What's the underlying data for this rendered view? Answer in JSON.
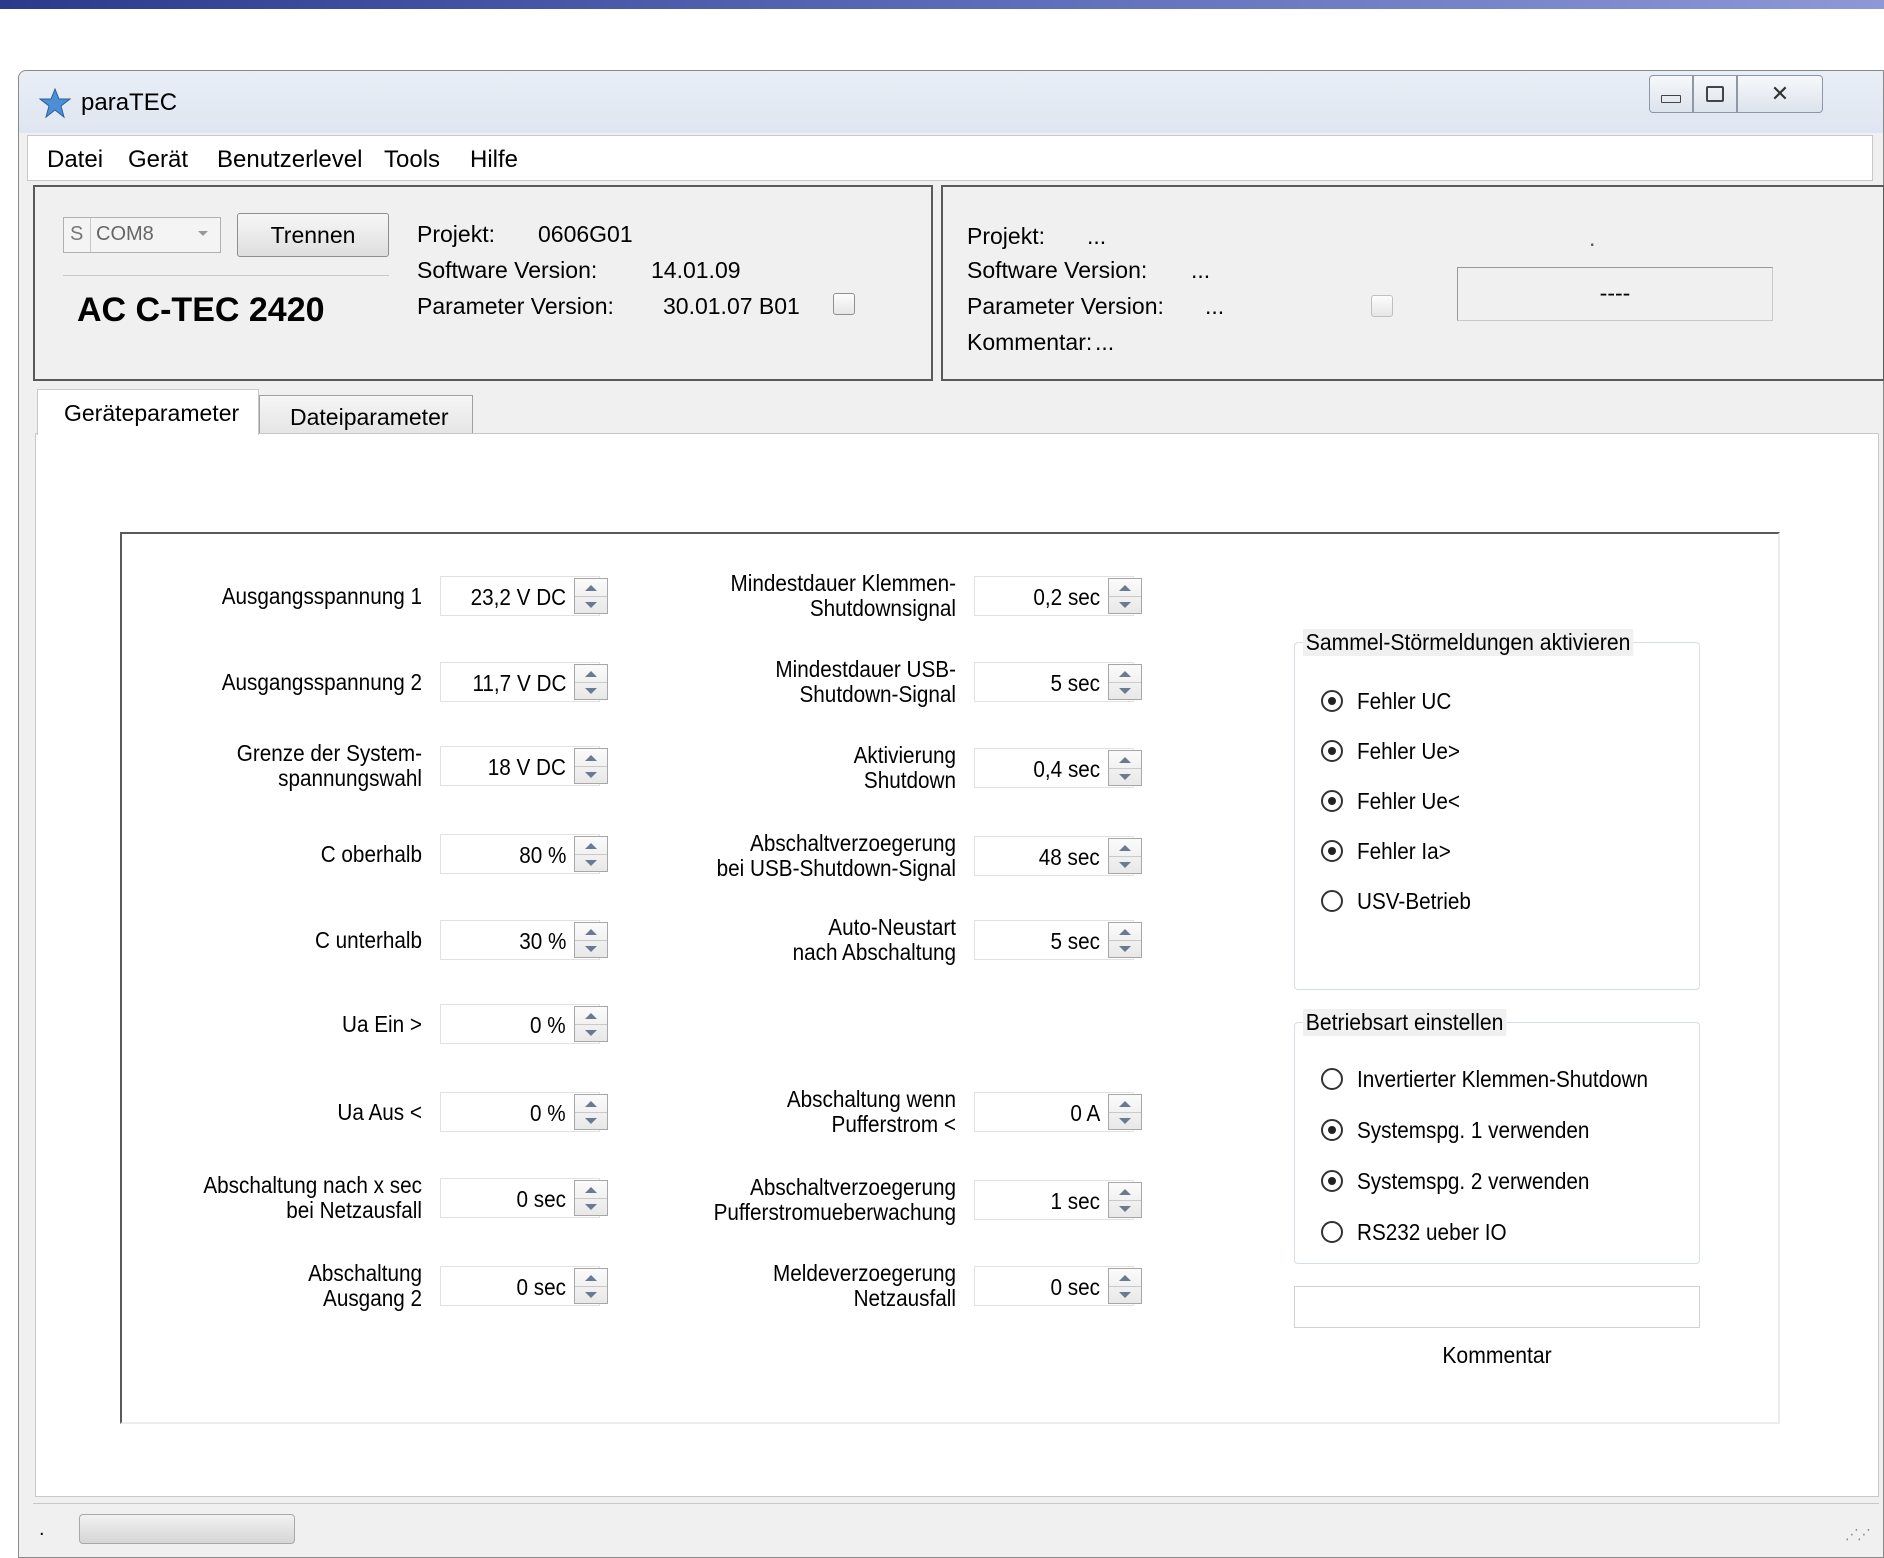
{
  "window": {
    "title": "paraTEC",
    "icon": "star-icon"
  },
  "menu": [
    "Datei",
    "Gerät",
    "Benutzerlevel",
    "Tools",
    "Hilfe"
  ],
  "connection": {
    "prefix": "S",
    "port": "COM8",
    "disconnect_label": "Trennen",
    "device_name": "AC C-TEC 2420",
    "project_label": "Projekt:",
    "project_value": "0606G01",
    "software_label": "Software Version:",
    "software_value": "14.01.09",
    "parameter_label": "Parameter Version:",
    "parameter_value": "30.01.07 B01",
    "parameter_checked": false
  },
  "file_info": {
    "project_label": "Projekt:",
    "project_value": "...",
    "software_label": "Software Version:",
    "software_value": "...",
    "parameter_label": "Parameter Version:",
    "parameter_value": "...",
    "comment_label": "Kommentar:",
    "comment_value": "...",
    "dot": ".",
    "display_value": "----"
  },
  "tabs": [
    "Geräteparameter",
    "Dateiparameter"
  ],
  "active_tab": "Geräteparameter",
  "left_params": [
    {
      "label": "Ausgangsspannung 1",
      "value": "23,2 V DC"
    },
    {
      "label": "Ausgangsspannung 2",
      "value": "11,7 V DC"
    },
    {
      "label": "Grenze der System-\nspannungswahl",
      "value": "18 V DC"
    },
    {
      "label": "C oberhalb",
      "value": "80 %"
    },
    {
      "label": "C unterhalb",
      "value": "30 %"
    },
    {
      "label": "Ua Ein  >",
      "value": "0 %"
    },
    {
      "label": "Ua Aus <",
      "value": "0 %"
    },
    {
      "label": "Abschaltung nach x sec\nbei Netzausfall",
      "value": "0 sec"
    },
    {
      "label": "Abschaltung\nAusgang 2",
      "value": "0 sec"
    }
  ],
  "mid_params": [
    {
      "label": "Mindestdauer Klemmen-\nShutdownsignal",
      "value": "0,2 sec"
    },
    {
      "label": "Mindestdauer USB-\nShutdown-Signal",
      "value": "5 sec"
    },
    {
      "label": "Aktivierung\nShutdown",
      "value": "0,4 sec"
    },
    {
      "label": "Abschaltverzoegerung\nbei USB-Shutdown-Signal",
      "value": "48 sec"
    },
    {
      "label": "Auto-Neustart\nnach Abschaltung",
      "value": "5 sec"
    },
    {
      "label": "Abschaltung wenn\nPufferstrom <",
      "value": "0 A"
    },
    {
      "label": "Abschaltverzoegerung\nPufferstromueberwachung",
      "value": "1 sec"
    },
    {
      "label": "Meldeverzoegerung\nNetzausfall",
      "value": "0 sec"
    }
  ],
  "group_faults": {
    "title": "Sammel-Störmeldungen aktivieren",
    "options": [
      {
        "label": "Fehler UC",
        "checked": true
      },
      {
        "label": "Fehler Ue>",
        "checked": true
      },
      {
        "label": "Fehler Ue<",
        "checked": true
      },
      {
        "label": "Fehler Ia>",
        "checked": true
      },
      {
        "label": "USV-Betrieb",
        "checked": false
      }
    ]
  },
  "group_mode": {
    "title": "Betriebsart einstellen",
    "options": [
      {
        "label": "Invertierter Klemmen-Shutdown",
        "checked": false
      },
      {
        "label": "Systemspg. 1 verwenden",
        "checked": true
      },
      {
        "label": "Systemspg. 2 verwenden",
        "checked": true
      },
      {
        "label": "RS232 ueber IO",
        "checked": false
      }
    ]
  },
  "comment": {
    "value": "",
    "label": "Kommentar"
  },
  "status": {
    "text": "."
  }
}
